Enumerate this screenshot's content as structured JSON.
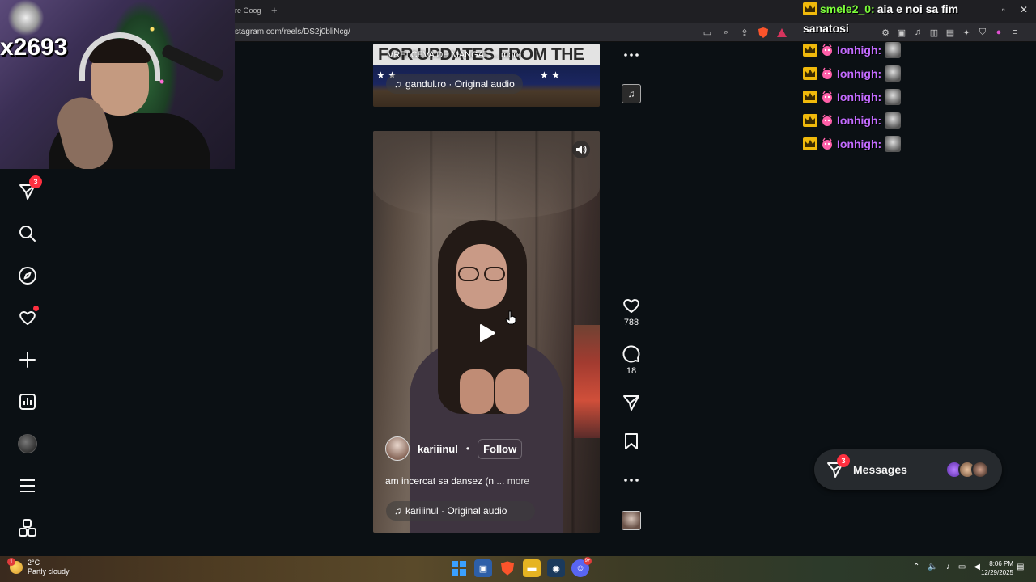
{
  "browser": {
    "tab_fragment": "re Goog",
    "new_tab_symbol": "+",
    "url": "stagram.com/reels/DS2j0bliNcg/",
    "window_close": "✕",
    "window_restore": "▫"
  },
  "nav": {
    "messages_badge": "3"
  },
  "reel_top": {
    "banner_text": "FOR UPDATES FROM THE",
    "caption_fragment": "VREI CEVA DE MANGAT ... more",
    "stars_left": "★ ★",
    "stars_right": "★ ★",
    "audio_label": "gandul.ro · Original audio"
  },
  "reel_main": {
    "author": "kariiinul",
    "separator": "•",
    "follow_label": "Follow",
    "caption": "am incercat sa dansez (n",
    "caption_more": "... more",
    "audio_label": "kariiinul · Original audio"
  },
  "actions": {
    "likes": "788",
    "comments": "18"
  },
  "messages": {
    "label": "Messages",
    "badge": "3"
  },
  "webcam": {
    "count": "x2693"
  },
  "chat": {
    "top_user": "smele2_0:",
    "top_message": "aia e noi sa fim",
    "wrap_text": "sanatosi",
    "lines": [
      {
        "user": "Ionhigh:"
      },
      {
        "user": "Ionhigh:"
      },
      {
        "user": "Ionhigh:"
      },
      {
        "user": "Ionhigh:"
      },
      {
        "user": "Ionhigh:"
      }
    ]
  },
  "taskbar": {
    "weather_temp": "2°C",
    "weather_desc": "Partly cloudy",
    "weather_badge": "1",
    "discord_badge": "9+",
    "time": "8:06 PM",
    "date": "12/29/2025"
  },
  "colors": {
    "instagram_red": "#ff3040",
    "chat_green": "#7cff3a",
    "chat_purple": "#c36bff",
    "page_bg": "#0b1014"
  }
}
